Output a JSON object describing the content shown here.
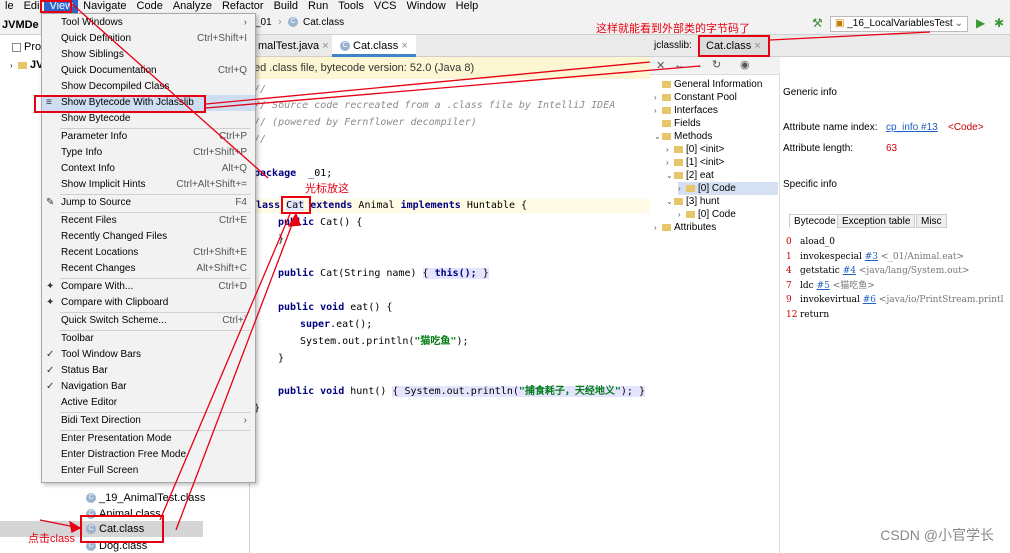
{
  "menubar": [
    "le",
    "Edi",
    "View",
    "Navigate",
    "Code",
    "Analyze",
    "Refactor",
    "Build",
    "Run",
    "Tools",
    "VCS",
    "Window",
    "Help"
  ],
  "navbar": {
    "crumb": "_01",
    "file": "Cat.class",
    "run_config": "_16_LocalVariablesTest"
  },
  "project": {
    "rows": {
      "project_label": "JVMDe",
      "pro_label": "Pro",
      "jvm_label": "JVM",
      "item_19": "_19_AnimalTest.class",
      "animal": "Animal.class",
      "cat": "Cat.class",
      "dog": "Dog.class"
    }
  },
  "view_menu": {
    "items": [
      {
        "label": "Tool Windows",
        "shortcut": "",
        "icon": ""
      },
      {
        "label": "Quick Definition",
        "shortcut": "Ctrl+Shift+I",
        "icon": ""
      },
      {
        "label": "Show Siblings",
        "shortcut": "",
        "icon": ""
      },
      {
        "label": "Quick Documentation",
        "shortcut": "Ctrl+Q",
        "icon": ""
      },
      {
        "label": "Show Decompiled Class",
        "shortcut": "",
        "icon": ""
      },
      {
        "label": "Show Bytecode With Jclasslib",
        "shortcut": "",
        "icon": "≡"
      },
      {
        "label": "Show Bytecode",
        "shortcut": "",
        "icon": ""
      },
      {
        "label": "Parameter Info",
        "shortcut": "Ctrl+P",
        "icon": ""
      },
      {
        "label": "Type Info",
        "shortcut": "Ctrl+Shift+P",
        "icon": ""
      },
      {
        "label": "Context Info",
        "shortcut": "Alt+Q",
        "icon": ""
      },
      {
        "label": "Show Implicit Hints",
        "shortcut": "Ctrl+Alt+Shift+=",
        "icon": ""
      },
      {
        "label": "Jump to Source",
        "shortcut": "F4",
        "icon": "✎"
      },
      {
        "label": "Recent Files",
        "shortcut": "Ctrl+E",
        "icon": ""
      },
      {
        "label": "Recently Changed Files",
        "shortcut": "",
        "icon": ""
      },
      {
        "label": "Recent Locations",
        "shortcut": "Ctrl+Shift+E",
        "icon": ""
      },
      {
        "label": "Recent Changes",
        "shortcut": "Alt+Shift+C",
        "icon": ""
      },
      {
        "label": "Compare With...",
        "shortcut": "Ctrl+D",
        "icon": "✦"
      },
      {
        "label": "Compare with Clipboard",
        "shortcut": "",
        "icon": "✦"
      },
      {
        "label": "Quick Switch Scheme...",
        "shortcut": "Ctrl+`",
        "icon": ""
      },
      {
        "label": "Toolbar",
        "shortcut": "",
        "icon": ""
      },
      {
        "label": "Tool Window Bars",
        "shortcut": "",
        "icon": "✓"
      },
      {
        "label": "Status Bar",
        "shortcut": "",
        "icon": "✓"
      },
      {
        "label": "Navigation Bar",
        "shortcut": "",
        "icon": "✓"
      },
      {
        "label": "Active Editor",
        "shortcut": "",
        "icon": ""
      },
      {
        "label": "Bidi Text Direction",
        "shortcut": "",
        "icon": ""
      },
      {
        "label": "Enter Presentation Mode",
        "shortcut": "",
        "icon": ""
      },
      {
        "label": "Enter Distraction Free Mode",
        "shortcut": "",
        "icon": ""
      },
      {
        "label": "Enter Full Screen",
        "shortcut": "",
        "icon": ""
      }
    ]
  },
  "editor": {
    "tabs": [
      "malTest.java",
      "Cat.class"
    ],
    "banner": "ed .class file, bytecode version: 52.0 (Java 8)",
    "lines": {
      "c1": "//",
      "c2": "// Source code recreated from a .class file by IntelliJ IDEA",
      "c3": "// (powered by Fernflower decompiler)",
      "c4": "//",
      "pkg": "_01;",
      "cls_name": "Cat",
      "cls_rest": "Animal",
      "cls_iface": "Huntable",
      "ctor1": "Cat() {",
      "close1": "}",
      "ctor2": "Cat(String name)",
      "ctor2_body": "this();",
      "eat": "eat() {",
      "super_eat": "eat();",
      "println": "System.out.println(",
      "str1": "\"猫吃鱼\"",
      "close2": "}",
      "hunt": "hunt()",
      "hunt_body": "System.out.println(",
      "str2": "\"捕食耗子，天经地义\"",
      "close3": "}"
    }
  },
  "jclasslib": {
    "label": "jclasslib:",
    "tab": "Cat.class",
    "tree": [
      "General Information",
      "Constant Pool",
      "Interfaces",
      "Fields",
      "Methods",
      "[0] <init>",
      "[1] <init>",
      "[2] eat",
      "[0] Code",
      "[3] hunt",
      "[0] Code",
      "Attributes"
    ],
    "generic_info": "Generic info",
    "attr_name_label": "Attribute name index:",
    "attr_name_link": "cp_info #13",
    "attr_name_value": "<Code>",
    "attr_len_label": "Attribute length:",
    "attr_len_value": "63",
    "specific_info": "Specific info",
    "bytecode_tabs": [
      "Bytecode",
      "Exception table",
      "Misc"
    ],
    "bytecode": [
      {
        "n": "0",
        "op": "aload_0",
        "link": "",
        "ref": ""
      },
      {
        "n": "1",
        "op": "invokespecial",
        "link": "#3",
        "ref": "<_01/Animal.eat>"
      },
      {
        "n": "4",
        "op": "getstatic",
        "link": "#4",
        "ref": "<java/lang/System.out>"
      },
      {
        "n": "7",
        "op": "ldc",
        "link": "#5",
        "ref": "<猫吃鱼>"
      },
      {
        "n": "9",
        "op": "invokevirtual",
        "link": "#6",
        "ref": "<java/io/PrintStream.printl"
      },
      {
        "n": "12",
        "op": "return",
        "link": "",
        "ref": ""
      }
    ]
  },
  "annotations": {
    "top_right": "这样就能看到外部类的字节码了",
    "cursor": "光标放这",
    "click": "点击class"
  },
  "watermark": "CSDN @小官学长",
  "colors": {
    "accent": "#2f65ca",
    "annotation": "#e60012"
  }
}
